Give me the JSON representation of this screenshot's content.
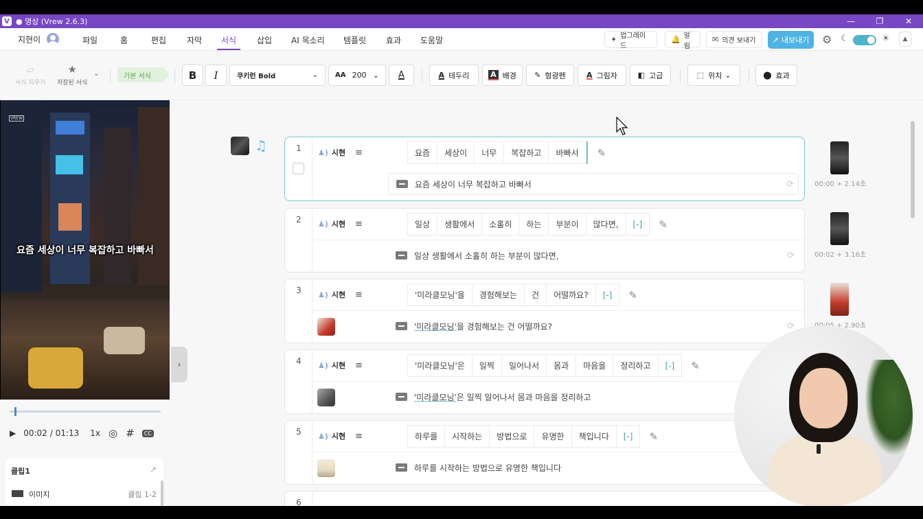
{
  "window": {
    "title": "● 영상 (Vrew 2.6.3)",
    "logo": "V"
  },
  "menu": {
    "user": "지현이",
    "items": [
      "파일",
      "홈",
      "편집",
      "자막",
      "서식",
      "삽입",
      "AI 목소리",
      "템플릿",
      "효과",
      "도움말"
    ],
    "active": "서식",
    "upgrade": "업그레이드",
    "notify": "알림",
    "feedback": "의견 보내기",
    "export": "내보내기"
  },
  "toolbar": {
    "clear_format": "서식 지우기",
    "saved_format": "저장된 서식",
    "basic_format": "기본 서식",
    "bold": "B",
    "italic": "I",
    "font": "쿠키런 Bold",
    "font_size": "200",
    "size_icon": "AA",
    "color_letter": "A",
    "outline": "테두리",
    "background": "배경",
    "highlighter": "형광펜",
    "shadow": "그림자",
    "advanced": "고급",
    "position": "위치",
    "effect": "효과"
  },
  "preview": {
    "caption": "요즘 세상이 너무 복잡하고 바빠서",
    "watermark": "VREW",
    "time_current": "00:02",
    "time_total": "/ 01:13",
    "speed": "1x",
    "progress": 0.03
  },
  "clip": {
    "title": "클립1",
    "item_label": "이미지",
    "item_range": "클립 1-2"
  },
  "rows": [
    {
      "num": "1",
      "speaker": "시현",
      "words": [
        "요즘",
        "세상이",
        "너무",
        "복잡하고",
        "바빠서"
      ],
      "bracket": "",
      "subtitle": "요즘 세상이 너무 복잡하고 바빠서",
      "time": "00:00 + 2.14초"
    },
    {
      "num": "2",
      "speaker": "시현",
      "words": [
        "일상",
        "생활에서",
        "소홀히",
        "하는",
        "부분이",
        "많다면,"
      ],
      "bracket": "[-]",
      "subtitle": "일상 생활에서 소홀히 하는 부분이 많다면,",
      "time": "00:02 + 3.16초"
    },
    {
      "num": "3",
      "speaker": "시현",
      "words": [
        "'미라클모닝'을",
        "경험해보는",
        "건",
        "어떨까요?"
      ],
      "bracket": "[-]",
      "subtitle_u": "'미라클모닝'",
      "subtitle_rest": "을 경험해보는 건 어떨까요?",
      "time": "00:05 + 2.90초"
    },
    {
      "num": "4",
      "speaker": "시현",
      "words": [
        "'미라클모닝'은",
        "일찍",
        "일어나서",
        "몸과",
        "마음을",
        "정리하고"
      ],
      "bracket": "[-]",
      "subtitle_u": "'미라클모닝'",
      "subtitle_rest": "은 일찍 일어나서 몸과 마음을 정리하고"
    },
    {
      "num": "5",
      "speaker": "시현",
      "words": [
        "하루를",
        "시작하는",
        "방법으로",
        "유명한",
        "책입니다"
      ],
      "bracket": "[-]",
      "subtitle": "하루를 시작하는 방법으로 유명한 책입니다"
    },
    {
      "num": "6"
    }
  ],
  "colors": {
    "accent": "#7747c5",
    "export": "#4fb3e4",
    "teal": "#6ccbd1"
  }
}
